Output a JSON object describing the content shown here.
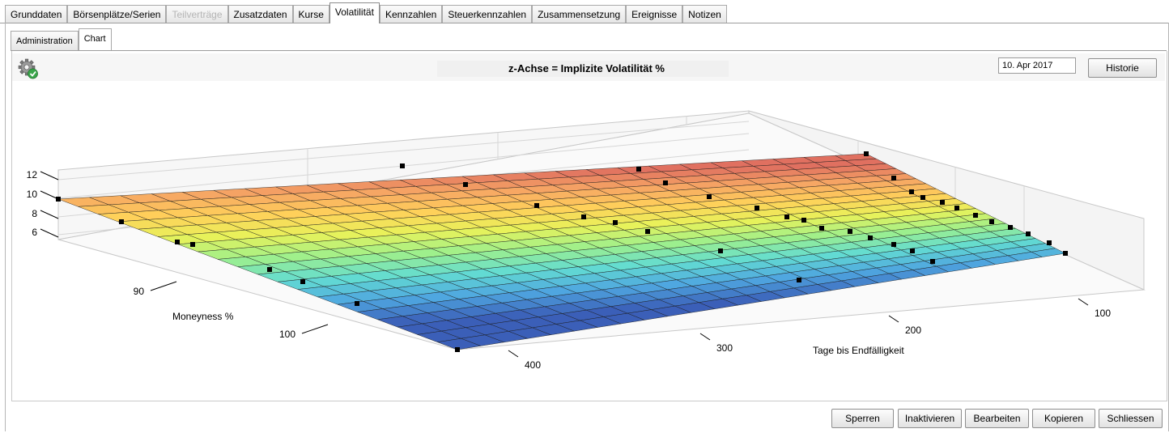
{
  "top_tabs": [
    {
      "label": "Grunddaten",
      "state": "normal"
    },
    {
      "label": "Börsenplätze/Serien",
      "state": "normal"
    },
    {
      "label": "Teilverträge",
      "state": "disabled"
    },
    {
      "label": "Zusatzdaten",
      "state": "normal"
    },
    {
      "label": "Kurse",
      "state": "normal"
    },
    {
      "label": "Volatilität",
      "state": "active"
    },
    {
      "label": "Kennzahlen",
      "state": "normal"
    },
    {
      "label": "Steuerkennzahlen",
      "state": "normal"
    },
    {
      "label": "Zusammensetzung",
      "state": "normal"
    },
    {
      "label": "Ereignisse",
      "state": "normal"
    },
    {
      "label": "Notizen",
      "state": "normal"
    }
  ],
  "sub_tabs": [
    {
      "label": "Administration",
      "state": "normal"
    },
    {
      "label": "Chart",
      "state": "active"
    }
  ],
  "chart_header": {
    "settings_icon": "gear-check-icon",
    "title": "z-Achse = Implizite Volatilität %",
    "date_value": "10. Apr 2017",
    "history_label": "Historie"
  },
  "chart_data": {
    "type": "surface",
    "z_label": "",
    "x_label": "Moneyness %",
    "y_label": "Tage bis Endfälligkeit",
    "z_ticks": [
      "12",
      "10",
      "8",
      "6"
    ],
    "x_ticks": [
      "90",
      "100"
    ],
    "y_ticks": [
      "400",
      "300",
      "200",
      "100"
    ],
    "x_range": [
      85,
      104
    ],
    "y_range": [
      45,
      420
    ],
    "z_range": [
      4,
      14
    ],
    "colormap": [
      "#3b5fb8",
      "#4fa6e0",
      "#63dcd2",
      "#9ef08c",
      "#e8f25a",
      "#ffd05a",
      "#f6a564",
      "#e07060"
    ],
    "grid": true,
    "note_points_marked": "black square markers along surface edges"
  },
  "footer_buttons": [
    {
      "label": "Sperren"
    },
    {
      "label": "Inaktivieren"
    },
    {
      "label": "Bearbeiten"
    },
    {
      "label": "Kopieren"
    },
    {
      "label": "Schliessen"
    }
  ]
}
